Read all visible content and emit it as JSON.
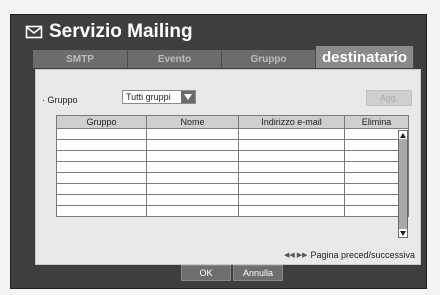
{
  "window": {
    "title": "Servizio Mailing",
    "title_icon": "envelope-icon"
  },
  "tabs": [
    {
      "label": "SMTP",
      "active": false
    },
    {
      "label": "Evento",
      "active": false
    },
    {
      "label": "Gruppo",
      "active": false
    },
    {
      "label": "destinatario",
      "active": true
    }
  ],
  "filter": {
    "label": "· Gruppo",
    "selected": "Tutti gruppi"
  },
  "add_button": "Agg.",
  "table": {
    "columns": [
      "Gruppo",
      "Nome",
      "Indirizzo e-mail",
      "Elimina"
    ],
    "rows": [
      [
        "",
        "",
        "",
        ""
      ],
      [
        "",
        "",
        "",
        ""
      ],
      [
        "",
        "",
        "",
        ""
      ],
      [
        "",
        "",
        "",
        ""
      ],
      [
        "",
        "",
        "",
        ""
      ],
      [
        "",
        "",
        "",
        ""
      ],
      [
        "",
        "",
        "",
        ""
      ],
      [
        "",
        "",
        "",
        ""
      ]
    ]
  },
  "pager": {
    "text": "Pagina preced/successiva",
    "icon": "prev-next-icon"
  },
  "footer": {
    "ok": "OK",
    "cancel": "Annulla"
  },
  "colors": {
    "window_bg": "#3e3e3e",
    "active_tab": "#8a8a8a",
    "panel_bg": "#e9e9e9"
  }
}
